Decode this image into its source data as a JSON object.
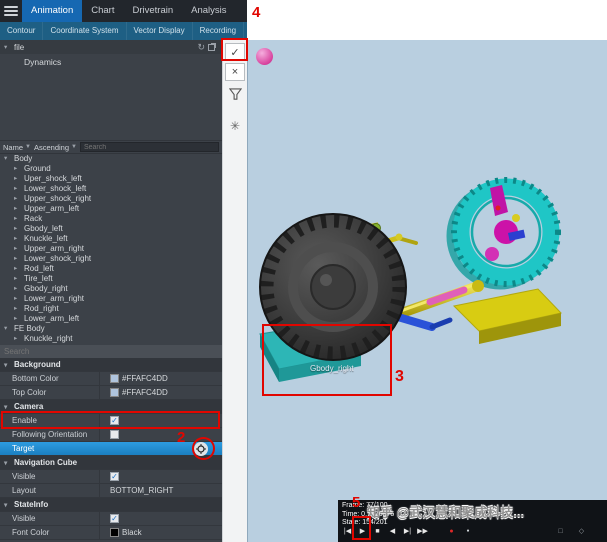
{
  "header": {
    "tabs": [
      {
        "label": "Animation",
        "active": true
      },
      {
        "label": "Chart",
        "active": false
      },
      {
        "label": "Drivetrain",
        "active": false
      },
      {
        "label": "Analysis",
        "active": false
      }
    ],
    "subtabs": [
      "Contour",
      "Coordinate System",
      "Vector Display",
      "Recording"
    ]
  },
  "file_panel": {
    "title": "file",
    "item": "Dynamics"
  },
  "tree": {
    "sort_field": "Name",
    "sort_order": "Ascending",
    "search_placeholder": "Search",
    "groups": [
      {
        "label": "Body",
        "children": [
          "Ground",
          "Uper_shock_left",
          "Lower_shock_left",
          "Upper_shock_right",
          "Upper_arm_left",
          "Rack",
          "Gbody_left",
          "Knuckle_left",
          "Upper_arm_right",
          "Lower_shock_right",
          "Rod_left",
          "Tire_left",
          "Gbody_right",
          "Lower_arm_right",
          "Rod_right",
          "Lower_arm_left"
        ]
      },
      {
        "label": "FE Body",
        "children": [
          "Knuckle_right"
        ]
      }
    ]
  },
  "properties": {
    "search_placeholder": "Search",
    "sections": [
      {
        "label": "Background",
        "rows": [
          {
            "name": "Bottom Color",
            "type": "color",
            "value": "#FFAFC4DD",
            "swatch": "#AFC4DD"
          },
          {
            "name": "Top Color",
            "type": "color",
            "value": "#FFAFC4DD",
            "swatch": "#AFC4DD"
          }
        ]
      },
      {
        "label": "Camera",
        "rows": [
          {
            "name": "Enable",
            "type": "checkbox",
            "checked": true
          },
          {
            "name": "Following Orientation",
            "type": "checkbox",
            "checked": false
          },
          {
            "name": "Target",
            "type": "target",
            "selected": true
          }
        ]
      },
      {
        "label": "Navigation Cube",
        "rows": [
          {
            "name": "Visible",
            "type": "checkbox",
            "checked": true
          },
          {
            "name": "Layout",
            "type": "text",
            "value": "BOTTOM_RIGHT"
          }
        ]
      },
      {
        "label": "StateInfo",
        "rows": [
          {
            "name": "Visible",
            "type": "checkbox",
            "checked": true
          },
          {
            "name": "Font Color",
            "type": "color",
            "value": "Black",
            "swatch": "#000000"
          }
        ]
      }
    ]
  },
  "side_toolbar": {
    "buttons": [
      {
        "name": "confirm-button",
        "glyph": "✓",
        "style": "button"
      },
      {
        "name": "cancel-button",
        "glyph": "×",
        "style": "button"
      },
      {
        "name": "filter-icon",
        "glyph": "funnel",
        "style": "icon"
      },
      {
        "name": "asterisk-icon",
        "glyph": "✳",
        "style": "icon"
      }
    ]
  },
  "viewport": {
    "model_label": "Gbody_right",
    "status": {
      "frame": "Frame: 77/100",
      "time": "Time: 0.7676375",
      "state": "State: 154/201"
    },
    "transport": [
      {
        "name": "first-frame-button",
        "glyph": "|◀"
      },
      {
        "name": "play-button",
        "glyph": "▶",
        "highlighted": true
      },
      {
        "name": "stop-button",
        "glyph": "■"
      },
      {
        "name": "reverse-play-button",
        "glyph": "◀"
      },
      {
        "name": "step-forward-button",
        "glyph": "▶|"
      },
      {
        "name": "fast-forward-button",
        "glyph": "▶▶"
      },
      {
        "name": "record-button",
        "glyph": "●",
        "color": "#e02828",
        "gap": 14
      },
      {
        "name": "keyframe-dot",
        "glyph": "●",
        "color": "#cfd4d8",
        "small": true,
        "gap": 4
      },
      {
        "name": "range-button",
        "glyph": "□",
        "color": "#9aa0a6",
        "gap": 80
      },
      {
        "name": "options-button",
        "glyph": "◇",
        "color": "#9aa0a6",
        "gap": 6
      }
    ]
  },
  "annotations": {
    "step2": "2",
    "step3": "3",
    "step4": "4",
    "step5": "5"
  },
  "watermark": "知乎 @武汉慧和聚成科技...",
  "colors": {
    "annotation_red": "#e10600",
    "active_tab_blue": "#1668b2",
    "selected_row_blue": "#1f8fd4",
    "viewport_bg": "#b9cfe0",
    "panel_bg": "#3c4148"
  }
}
